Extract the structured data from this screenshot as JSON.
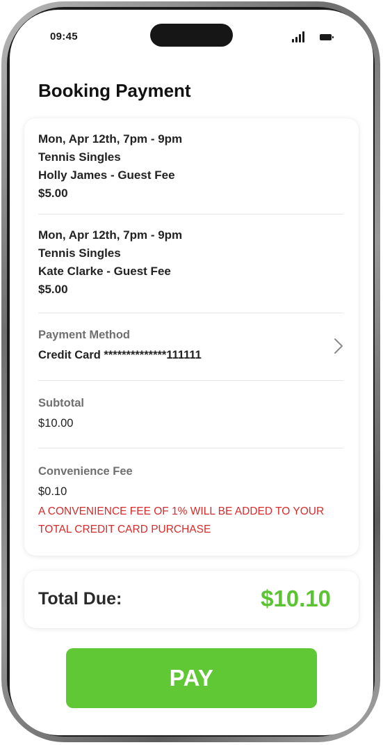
{
  "status_bar": {
    "time": "09:45",
    "icons": [
      "signal-icon",
      "battery-icon"
    ]
  },
  "page": {
    "title": "Booking Payment"
  },
  "bookings": [
    {
      "date": "Mon, Apr 12th, 7pm - 9pm",
      "activity": "Tennis Singles",
      "guest_fee": "Holly James - Guest Fee",
      "amount": "$5.00"
    },
    {
      "date": "Mon, Apr 12th, 7pm - 9pm",
      "activity": "Tennis Singles",
      "guest_fee": "Kate Clarke - Guest Fee",
      "amount": "$5.00"
    }
  ],
  "payment_method": {
    "label": "Payment Method",
    "value": "Credit Card **************111111",
    "icon": "chevron-right-icon"
  },
  "subtotal": {
    "label": "Subtotal",
    "value": "$10.00"
  },
  "convenience_fee": {
    "label": "Convenience Fee",
    "value": "$0.10",
    "warning_line1": "A CONVENIENCE FEE OF 1% WILL BE ADDED TO YOUR",
    "warning_line2": "TOTAL CREDIT CARD PURCHASE"
  },
  "total": {
    "label": "Total Due:",
    "value": "$10.10"
  },
  "pay_button": {
    "label": "PAY"
  },
  "colors": {
    "accent_green": "#5fc834",
    "total_green": "#5cc433",
    "warning_red": "#d82a2a"
  }
}
